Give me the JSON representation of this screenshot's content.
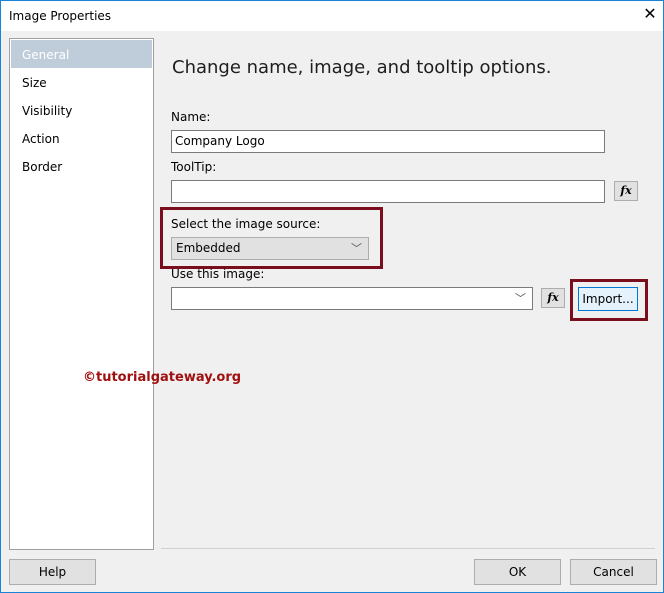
{
  "window": {
    "title": "Image Properties",
    "close": "✕"
  },
  "nav": {
    "items": [
      {
        "label": "General",
        "selected": true
      },
      {
        "label": "Size"
      },
      {
        "label": "Visibility"
      },
      {
        "label": "Action"
      },
      {
        "label": "Border"
      }
    ]
  },
  "main": {
    "heading": "Change name, image, and tooltip options.",
    "name_label": "Name:",
    "name_value": "Company Logo",
    "tooltip_label": "ToolTip:",
    "tooltip_value": "",
    "fx": "fx",
    "source_label": "Select the image source:",
    "source_value": "Embedded",
    "image_label": "Use this image:",
    "image_value": "",
    "import": "Import..."
  },
  "watermark": "©tutorialgateway.org",
  "footer": {
    "help": "Help",
    "ok": "OK",
    "cancel": "Cancel"
  }
}
